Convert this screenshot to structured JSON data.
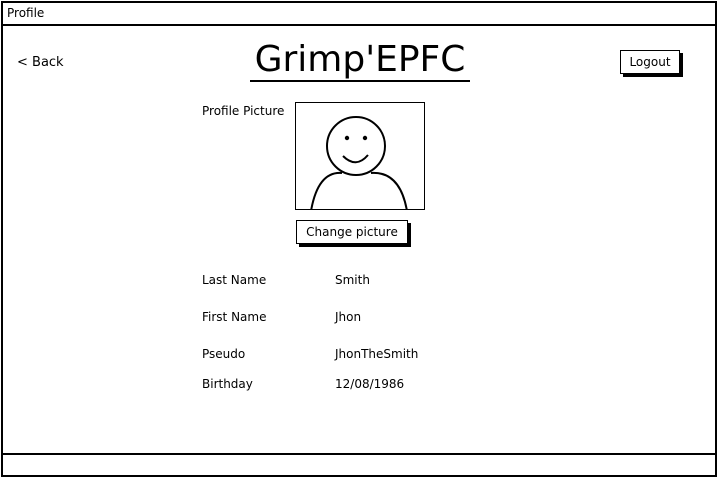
{
  "window": {
    "title": "Profile"
  },
  "nav": {
    "back_label": "< Back",
    "logout_label": "Logout"
  },
  "app": {
    "title": "Grimp'EPFC"
  },
  "profile": {
    "picture_label": "Profile Picture",
    "change_picture_label": "Change picture",
    "fields": [
      {
        "label": "Last Name",
        "value": "Smith"
      },
      {
        "label": "First Name",
        "value": "Jhon"
      },
      {
        "label": "Pseudo",
        "value": "JhonTheSmith"
      },
      {
        "label": "Birthday",
        "value": "12/08/1986"
      }
    ]
  },
  "icons": {
    "avatar": "user-avatar-icon"
  }
}
